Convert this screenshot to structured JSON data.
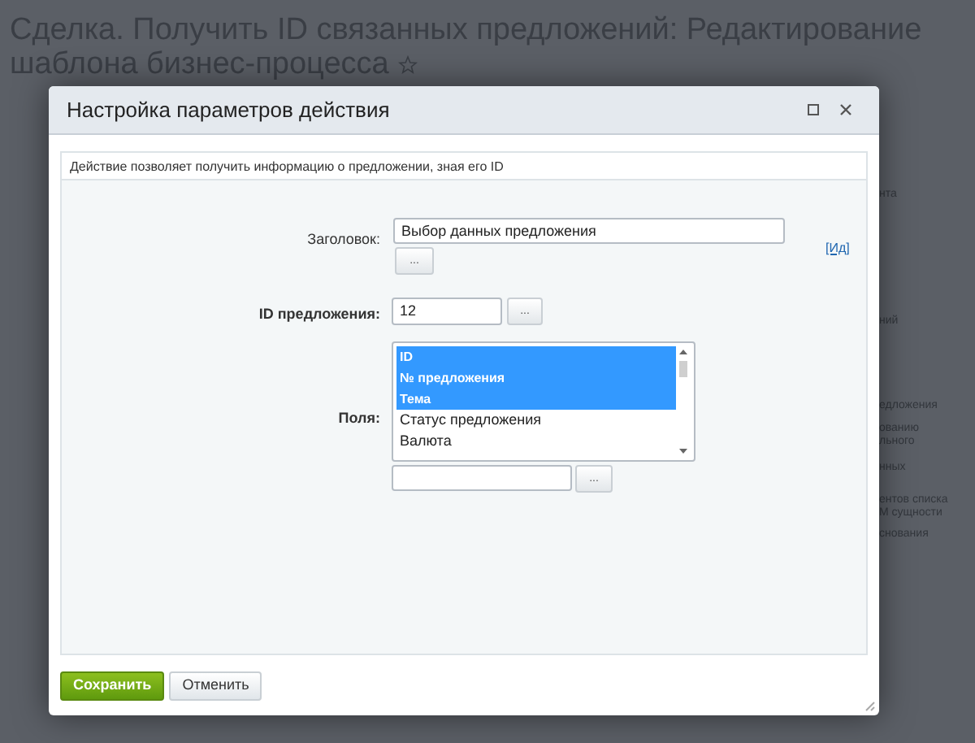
{
  "page_title": "Сделка. Получить ID связанных предложений: Редактирование шаблона бизнес-процесса",
  "background_fragments": [
    "нта",
    "ний",
    "едложения",
    "ованию",
    "льного",
    "нных",
    "ентов списка",
    "М сущности",
    "снования"
  ],
  "dialog": {
    "title": "Настройка параметров действия",
    "description": "Действие позволяет получить информацию о предложении, зная его ID",
    "title_field": {
      "label": "Заголовок:",
      "value": "Выбор данных предложения",
      "button": "...",
      "link": "[Ид]"
    },
    "id_field": {
      "label": "ID предложения:",
      "value": "12",
      "button": "..."
    },
    "fields": {
      "label": "Поля:",
      "options": [
        {
          "label": "ID",
          "selected": true
        },
        {
          "label": "№ предложения",
          "selected": true
        },
        {
          "label": "Тема",
          "selected": true
        },
        {
          "label": "Статус предложения",
          "selected": false
        },
        {
          "label": "Валюта",
          "selected": false
        }
      ],
      "extra_button": "..."
    },
    "buttons": [
      {
        "label": "Сохранить",
        "kind": "primary"
      },
      {
        "label": "Отменить",
        "kind": "secondary"
      }
    ]
  }
}
